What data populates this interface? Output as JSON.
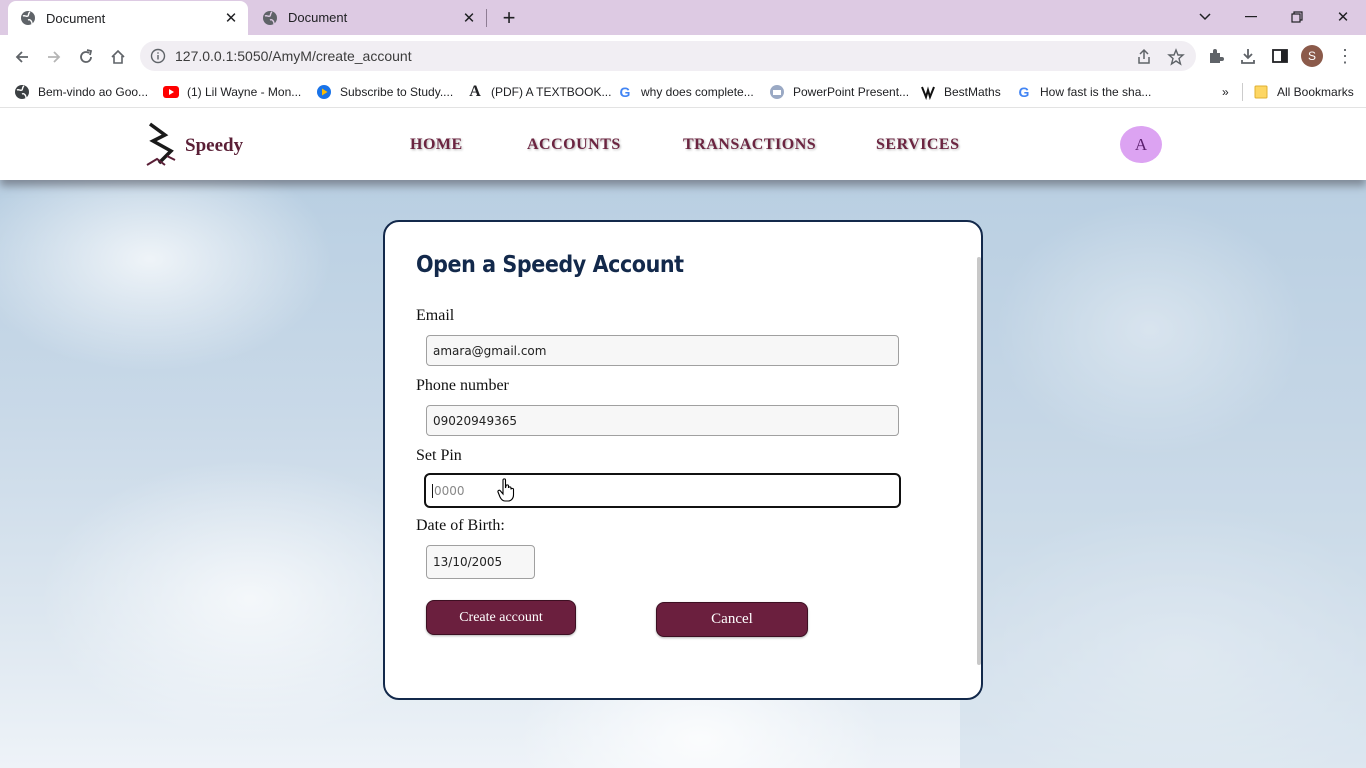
{
  "browser": {
    "tabs": [
      {
        "title": "Document",
        "active": true
      },
      {
        "title": "Document",
        "active": false
      }
    ],
    "url": "127.0.0.1:5050/AmyM/create_account",
    "profile_initial": "S",
    "bookmarks": [
      {
        "label": "Bem-vindo ao Goo...",
        "icon": "globe-icon"
      },
      {
        "label": "(1) Lil Wayne - Mon...",
        "icon": "youtube-icon"
      },
      {
        "label": "Subscribe to Study....",
        "icon": "play-icon"
      },
      {
        "label": "(PDF) A TEXTBOOK...",
        "icon": "academia-icon"
      },
      {
        "label": "why does complete...",
        "icon": "google-icon"
      },
      {
        "label": "PowerPoint Present...",
        "icon": "slides-icon"
      },
      {
        "label": "BestMaths",
        "icon": "bestmaths-icon"
      },
      {
        "label": "How fast is the sha...",
        "icon": "google-icon"
      }
    ],
    "all_bookmarks_label": "All Bookmarks"
  },
  "site": {
    "brand": "Speedy",
    "nav": [
      "HOME",
      "ACCOUNTS",
      "TRANSACTIONS",
      "SERVICES"
    ],
    "avatar_initial": "A"
  },
  "form": {
    "title": "Open a Speedy Account",
    "email_label": "Email",
    "email_value": "amara@gmail.com",
    "phone_label": "Phone number",
    "phone_value": "09020949365",
    "pin_label": "Set Pin",
    "pin_placeholder": "0000",
    "dob_label": "Date of Birth:",
    "dob_value": "13/10/2005",
    "create_label": "Create account",
    "cancel_label": "Cancel"
  },
  "colors": {
    "accent": "#6b1f3e",
    "title": "#13294b",
    "tabstrip": "#ddcae3",
    "avatar": "#dca3f2"
  }
}
